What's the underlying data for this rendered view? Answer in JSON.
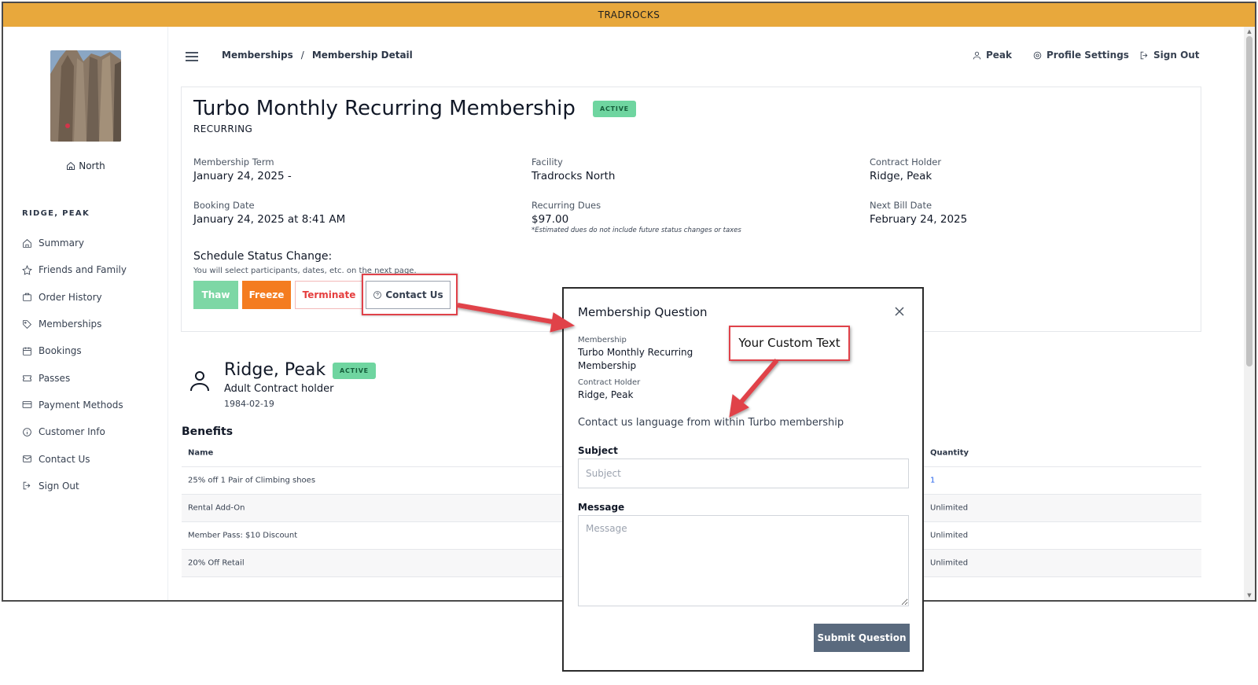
{
  "app": {
    "title": "TRADROCKS"
  },
  "sidebar": {
    "location": "North",
    "user_heading": "RIDGE, PEAK",
    "items": [
      {
        "label": "Summary",
        "icon": "home-icon"
      },
      {
        "label": "Friends and Family",
        "icon": "star-icon"
      },
      {
        "label": "Order History",
        "icon": "bag-icon"
      },
      {
        "label": "Memberships",
        "icon": "tag-icon"
      },
      {
        "label": "Bookings",
        "icon": "calendar-icon"
      },
      {
        "label": "Passes",
        "icon": "ticket-icon"
      },
      {
        "label": "Payment Methods",
        "icon": "credit-card-icon"
      },
      {
        "label": "Customer Info",
        "icon": "info-icon"
      },
      {
        "label": "Contact Us",
        "icon": "mail-icon"
      },
      {
        "label": "Sign Out",
        "icon": "sign-out-icon"
      }
    ]
  },
  "header": {
    "breadcrumb": {
      "first": "Memberships",
      "separator": "/",
      "current": "Membership Detail"
    },
    "user_link": "Peak",
    "profile_link": "Profile Settings",
    "signout_link": "Sign Out"
  },
  "membership": {
    "title": "Turbo Monthly Recurring Membership",
    "status": "ACTIVE",
    "type": "RECURRING",
    "fields": {
      "term_label": "Membership Term",
      "term_value": "January 24, 2025 -",
      "facility_label": "Facility",
      "facility_value": "Tradrocks North",
      "holder_label": "Contract Holder",
      "holder_value": "Ridge, Peak",
      "booking_label": "Booking Date",
      "booking_value": "January 24, 2025 at 8:41 AM",
      "dues_label": "Recurring Dues",
      "dues_value": "$97.00",
      "dues_note": "*Estimated dues do not include future status changes or taxes",
      "nextbill_label": "Next Bill Date",
      "nextbill_value": "February 24, 2025"
    },
    "schedule": {
      "title": "Schedule Status Change:",
      "description": "You will select participants, dates, etc. on the next page.",
      "thaw": "Thaw",
      "freeze": "Freeze",
      "terminate": "Terminate",
      "contact": "Contact Us"
    }
  },
  "person": {
    "name": "Ridge, Peak",
    "status": "ACTIVE",
    "role": "Adult Contract holder",
    "dob": "1984-02-19"
  },
  "benefits": {
    "title": "Benefits",
    "col_name": "Name",
    "col_quantity": "Quantity",
    "rows": [
      {
        "name": "25% off 1 Pair of Climbing shoes",
        "quantity": "1"
      },
      {
        "name": "Rental Add-On",
        "quantity": "Unlimited"
      },
      {
        "name": "Member Pass: $10 Discount",
        "quantity": "Unlimited"
      },
      {
        "name": "20% Off Retail",
        "quantity": "Unlimited"
      }
    ]
  },
  "modal": {
    "title": "Membership Question",
    "membership_label": "Membership",
    "membership_value_line1": "Turbo Monthly Recurring",
    "membership_value_line2": "Membership",
    "holder_label": "Contract Holder",
    "holder_value": "Ridge, Peak",
    "body": "Contact us language from within Turbo membership",
    "subject_label": "Subject",
    "subject_placeholder": "Subject",
    "message_label": "Message",
    "message_placeholder": "Message",
    "submit": "Submit Question"
  },
  "annotation": {
    "callout": "Your Custom Text",
    "color": "#e0424a"
  },
  "colors": {
    "topbar": "#e8a83c",
    "active_badge": "#6fd5a0",
    "thaw": "#7dd7a5",
    "freeze": "#f47c20",
    "terminate": "#e53e3e",
    "submit": "#5a6a7e"
  }
}
